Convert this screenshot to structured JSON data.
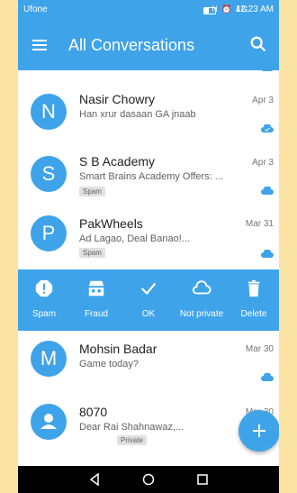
{
  "status": {
    "carrier": "Ufone",
    "icons": "N ⏰ 4G",
    "time": "12:23 AM"
  },
  "appbar": {
    "title": "All Conversations"
  },
  "conversations": [
    {
      "avatar": "N",
      "name": "Nasir Chowry",
      "preview": "Han xrur dasaan GA jnaab",
      "date": "Apr 3",
      "tag": ""
    },
    {
      "avatar": "S",
      "name": "S B Academy",
      "preview": "Smart Brains Academy Offers: ...",
      "date": "Apr 3",
      "tag": "Spam"
    },
    {
      "avatar": "P",
      "name": "PakWheels",
      "preview": "Ad Lagao, Deal Banao!...",
      "date": "Mar 31",
      "tag": "Spam"
    },
    {
      "avatar": "M",
      "name": "Mohsin Badar",
      "preview": "Game today?",
      "date": "Mar 30",
      "tag": ""
    },
    {
      "avatar": "person-icon",
      "name": "8070",
      "preview": "Dear Rai Shahnawaz,...",
      "date": "Mar 30",
      "tag": "Private"
    }
  ],
  "actions": [
    {
      "icon": "alert-icon",
      "label": "Spam"
    },
    {
      "icon": "fraud-icon",
      "label": "Fraud"
    },
    {
      "icon": "check-icon",
      "label": "OK"
    },
    {
      "icon": "cloud-icon",
      "label": "Not private"
    },
    {
      "icon": "trash-icon",
      "label": "Delete"
    }
  ],
  "colors": {
    "accent": "#3fa3ea",
    "background": "#fbe3a3"
  }
}
